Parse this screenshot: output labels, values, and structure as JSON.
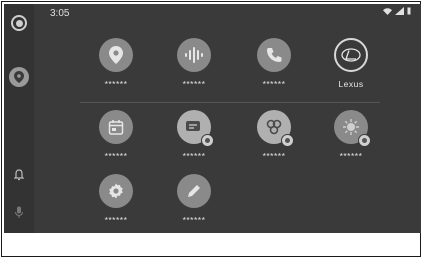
{
  "status_bar": {
    "time": "3:05",
    "icons": [
      "wifi-icon",
      "signal-icon",
      "battery-icon"
    ]
  },
  "rail": {
    "items": [
      "home-icon",
      "maps-icon",
      "notification-bell-icon",
      "microphone-icon"
    ]
  },
  "apps": [
    {
      "label": "******",
      "icon": "maps-pin-icon"
    },
    {
      "label": "******",
      "icon": "podcast-icon"
    },
    {
      "label": "******",
      "icon": "phone-icon"
    },
    {
      "label": "Lexus",
      "icon": "lexus-logo-icon"
    },
    {
      "label": "******",
      "icon": "calendar-icon"
    },
    {
      "label": "******",
      "icon": "messages-icon"
    },
    {
      "label": "******",
      "icon": "assistant-icon"
    },
    {
      "label": "******",
      "icon": "weather-icon"
    },
    {
      "label": "******",
      "icon": "settings-icon"
    },
    {
      "label": "******",
      "icon": "edit-pencil-icon"
    }
  ],
  "colors": {
    "screen": "#3a3a3a",
    "rail": "#333333",
    "icon_fill": "#8a8a8a",
    "text": "#e6e6e6"
  }
}
